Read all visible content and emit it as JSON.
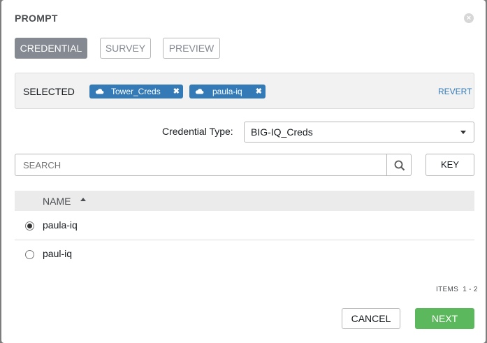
{
  "modal": {
    "title": "PROMPT",
    "close_glyph": "×"
  },
  "tabs": [
    {
      "label": "CREDENTIAL",
      "active": true
    },
    {
      "label": "SURVEY",
      "active": false
    },
    {
      "label": "PREVIEW",
      "active": false
    }
  ],
  "selected": {
    "label": "SELECTED",
    "chips": [
      {
        "label": "Tower_Creds",
        "icon": "cloud-icon"
      },
      {
        "label": "paula-iq",
        "icon": "cloud-icon"
      }
    ],
    "revert_label": "REVERT"
  },
  "credential_type": {
    "label": "Credential Type:",
    "value": "BIG-IQ_Creds"
  },
  "search": {
    "placeholder": "SEARCH",
    "key_label": "KEY"
  },
  "table": {
    "header": "NAME",
    "sort": "ascending",
    "rows": [
      {
        "name": "paula-iq",
        "selected": true
      },
      {
        "name": "paul-iq",
        "selected": false
      }
    ]
  },
  "pagination": {
    "items": "ITEMS  1 - 2"
  },
  "footer": {
    "cancel_label": "CANCEL",
    "next_label": "NEXT"
  },
  "colors": {
    "primary": "#337ab7",
    "success": "#5cb85c",
    "active_tab": "#848992"
  }
}
